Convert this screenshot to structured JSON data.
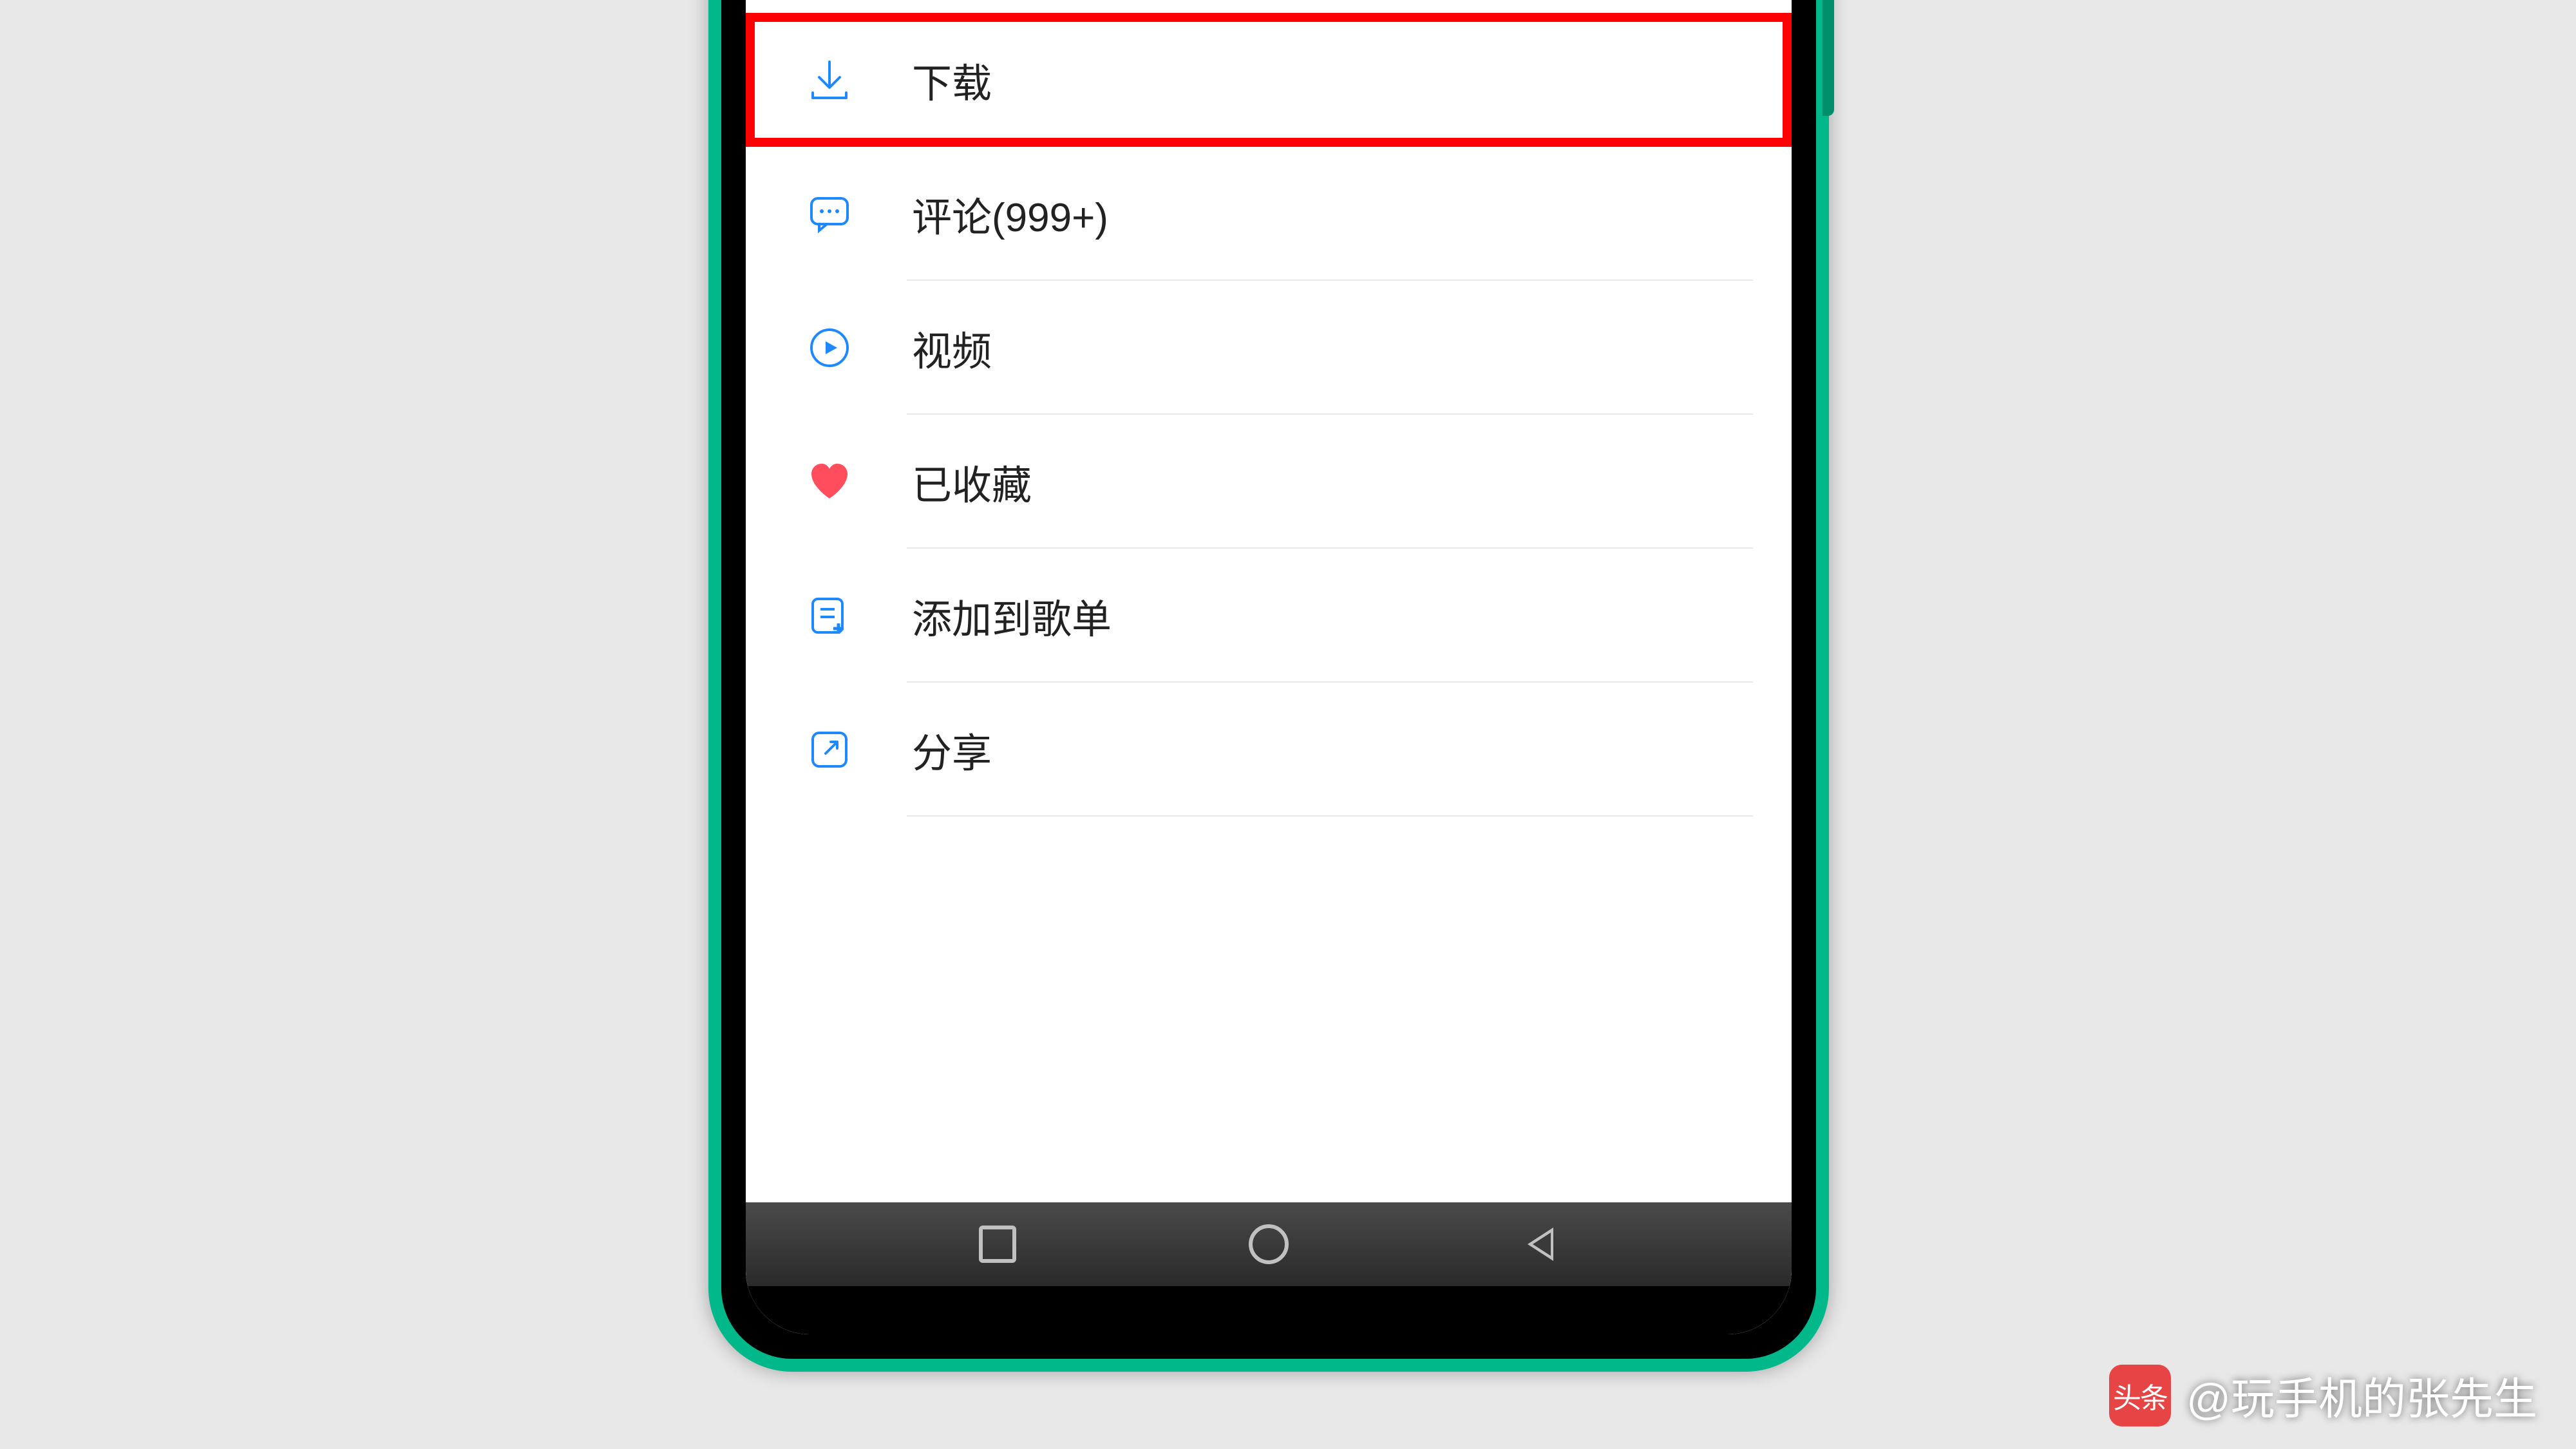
{
  "menu": {
    "items": [
      {
        "key": "download",
        "label": "下载",
        "highlighted": true
      },
      {
        "key": "comments",
        "label": "评论(999+)"
      },
      {
        "key": "video",
        "label": "视频"
      },
      {
        "key": "favorited",
        "label": "已收藏"
      },
      {
        "key": "add_playlist",
        "label": "添加到歌单"
      },
      {
        "key": "share",
        "label": "分享"
      }
    ]
  },
  "watermark": {
    "logo_text": "头条",
    "handle": "@玩手机的张先生"
  }
}
